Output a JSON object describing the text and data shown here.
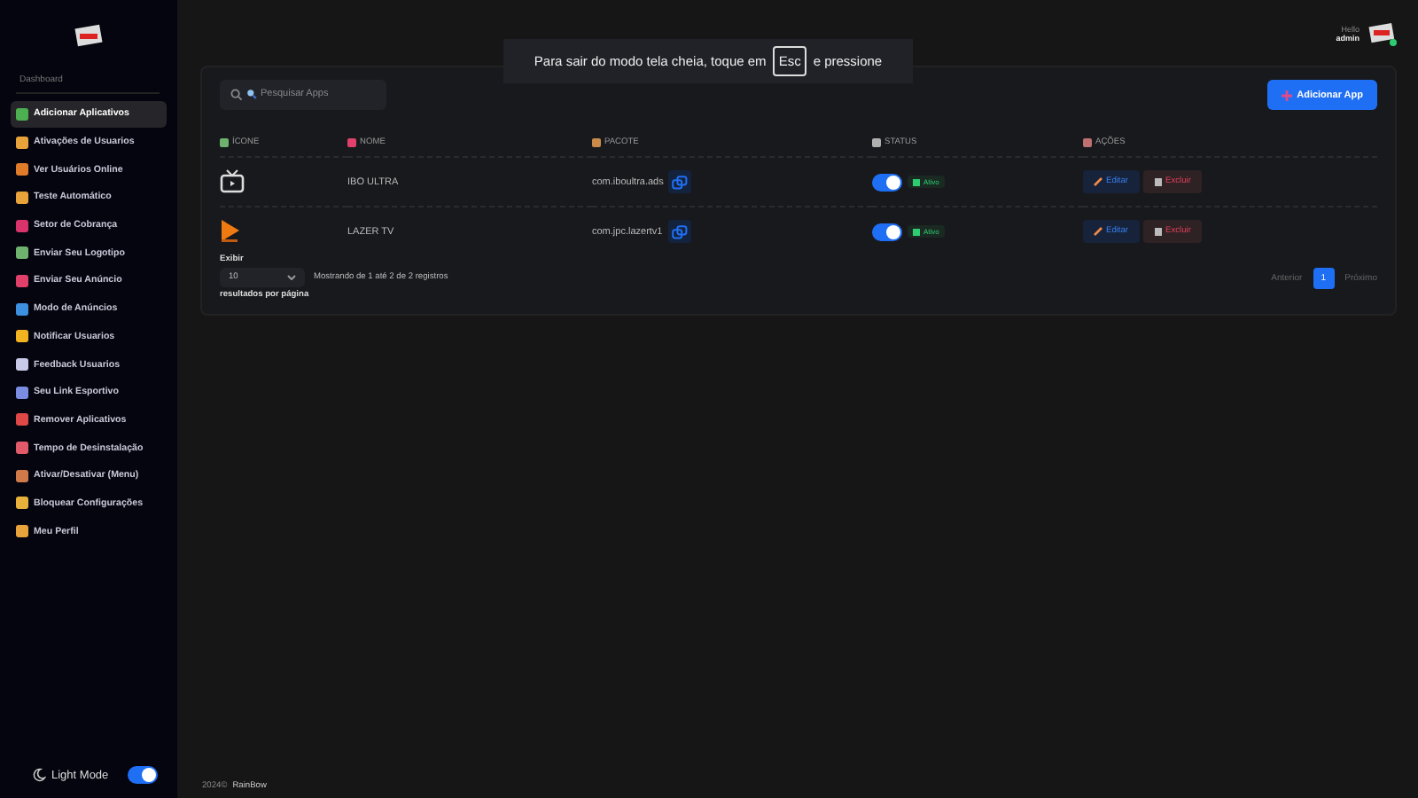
{
  "sidebar": {
    "section_title": "Dashboard",
    "items": [
      {
        "label": "Adicionar Aplicativos",
        "selected": true,
        "color": "#4caf50"
      },
      {
        "label": "Ativações de Usuarios",
        "selected": false,
        "color": "#e8a33b"
      },
      {
        "label": "Ver Usuários Online",
        "selected": false,
        "color": "#e07b2a"
      },
      {
        "label": "Teste Automático",
        "selected": false,
        "color": "#e8a33b"
      },
      {
        "label": "Setor de Cobrança",
        "selected": false,
        "color": "#d8336b"
      },
      {
        "label": "Enviar Seu Logotipo",
        "selected": false,
        "color": "#6db36d"
      },
      {
        "label": "Enviar Seu Anúncio",
        "selected": false,
        "color": "#e0406a"
      },
      {
        "label": "Modo de Anúncios",
        "selected": false,
        "color": "#3d8fe0"
      },
      {
        "label": "Notificar Usuarios",
        "selected": false,
        "color": "#f2b321"
      },
      {
        "label": "Feedback Usuarios",
        "selected": false,
        "color": "#c9c9e8"
      },
      {
        "label": "Seu Link Esportivo",
        "selected": false,
        "color": "#7a8de0"
      },
      {
        "label": "Remover Aplicativos",
        "selected": false,
        "color": "#e04848"
      },
      {
        "label": "Tempo de Desinstalação",
        "selected": false,
        "color": "#e05a6a"
      },
      {
        "label": "Ativar/Desativar (Menu)",
        "selected": false,
        "color": "#d07a4a"
      },
      {
        "label": "Bloquear Configurações",
        "selected": false,
        "color": "#e8b13b"
      },
      {
        "label": "Meu Perfil",
        "selected": false,
        "color": "#e8a33b"
      }
    ],
    "light_mode": {
      "label": "Light Mode",
      "on": true
    }
  },
  "header": {
    "greeting": "Hello",
    "user": "admin"
  },
  "fullscreen_notice": {
    "before": "Para sair do modo tela cheia, toque em",
    "key": "Esc",
    "after": "e pressione"
  },
  "search": {
    "placeholder": "Pesquisar Apps"
  },
  "add_button": "Adicionar App",
  "table": {
    "columns": [
      "ÍCONE",
      "NOME",
      "PACOTE",
      "STATUS",
      "AÇÕES"
    ],
    "rows": [
      {
        "kind": "tv",
        "name": "IBO ULTRA",
        "package": "com.iboultra.ads",
        "active": true,
        "status": "Ativo",
        "edit": "Editar",
        "delete": "Excluir"
      },
      {
        "kind": "play",
        "name": "LAZER TV",
        "package": "com.jpc.lazertv1",
        "active": true,
        "status": "Ativo",
        "edit": "Editar",
        "delete": "Excluir"
      }
    ]
  },
  "page_size": {
    "label": "Exibir",
    "value": "10",
    "suffix": "resultados por página"
  },
  "info": "Mostrando de 1 até 2 de 2 registros",
  "pagination": {
    "previous": "Anterior",
    "pages": [
      {
        "label": "1",
        "selected": true
      }
    ],
    "next": "Próximo"
  },
  "footer": {
    "copyright": "2024©",
    "brand": "RainBow"
  }
}
